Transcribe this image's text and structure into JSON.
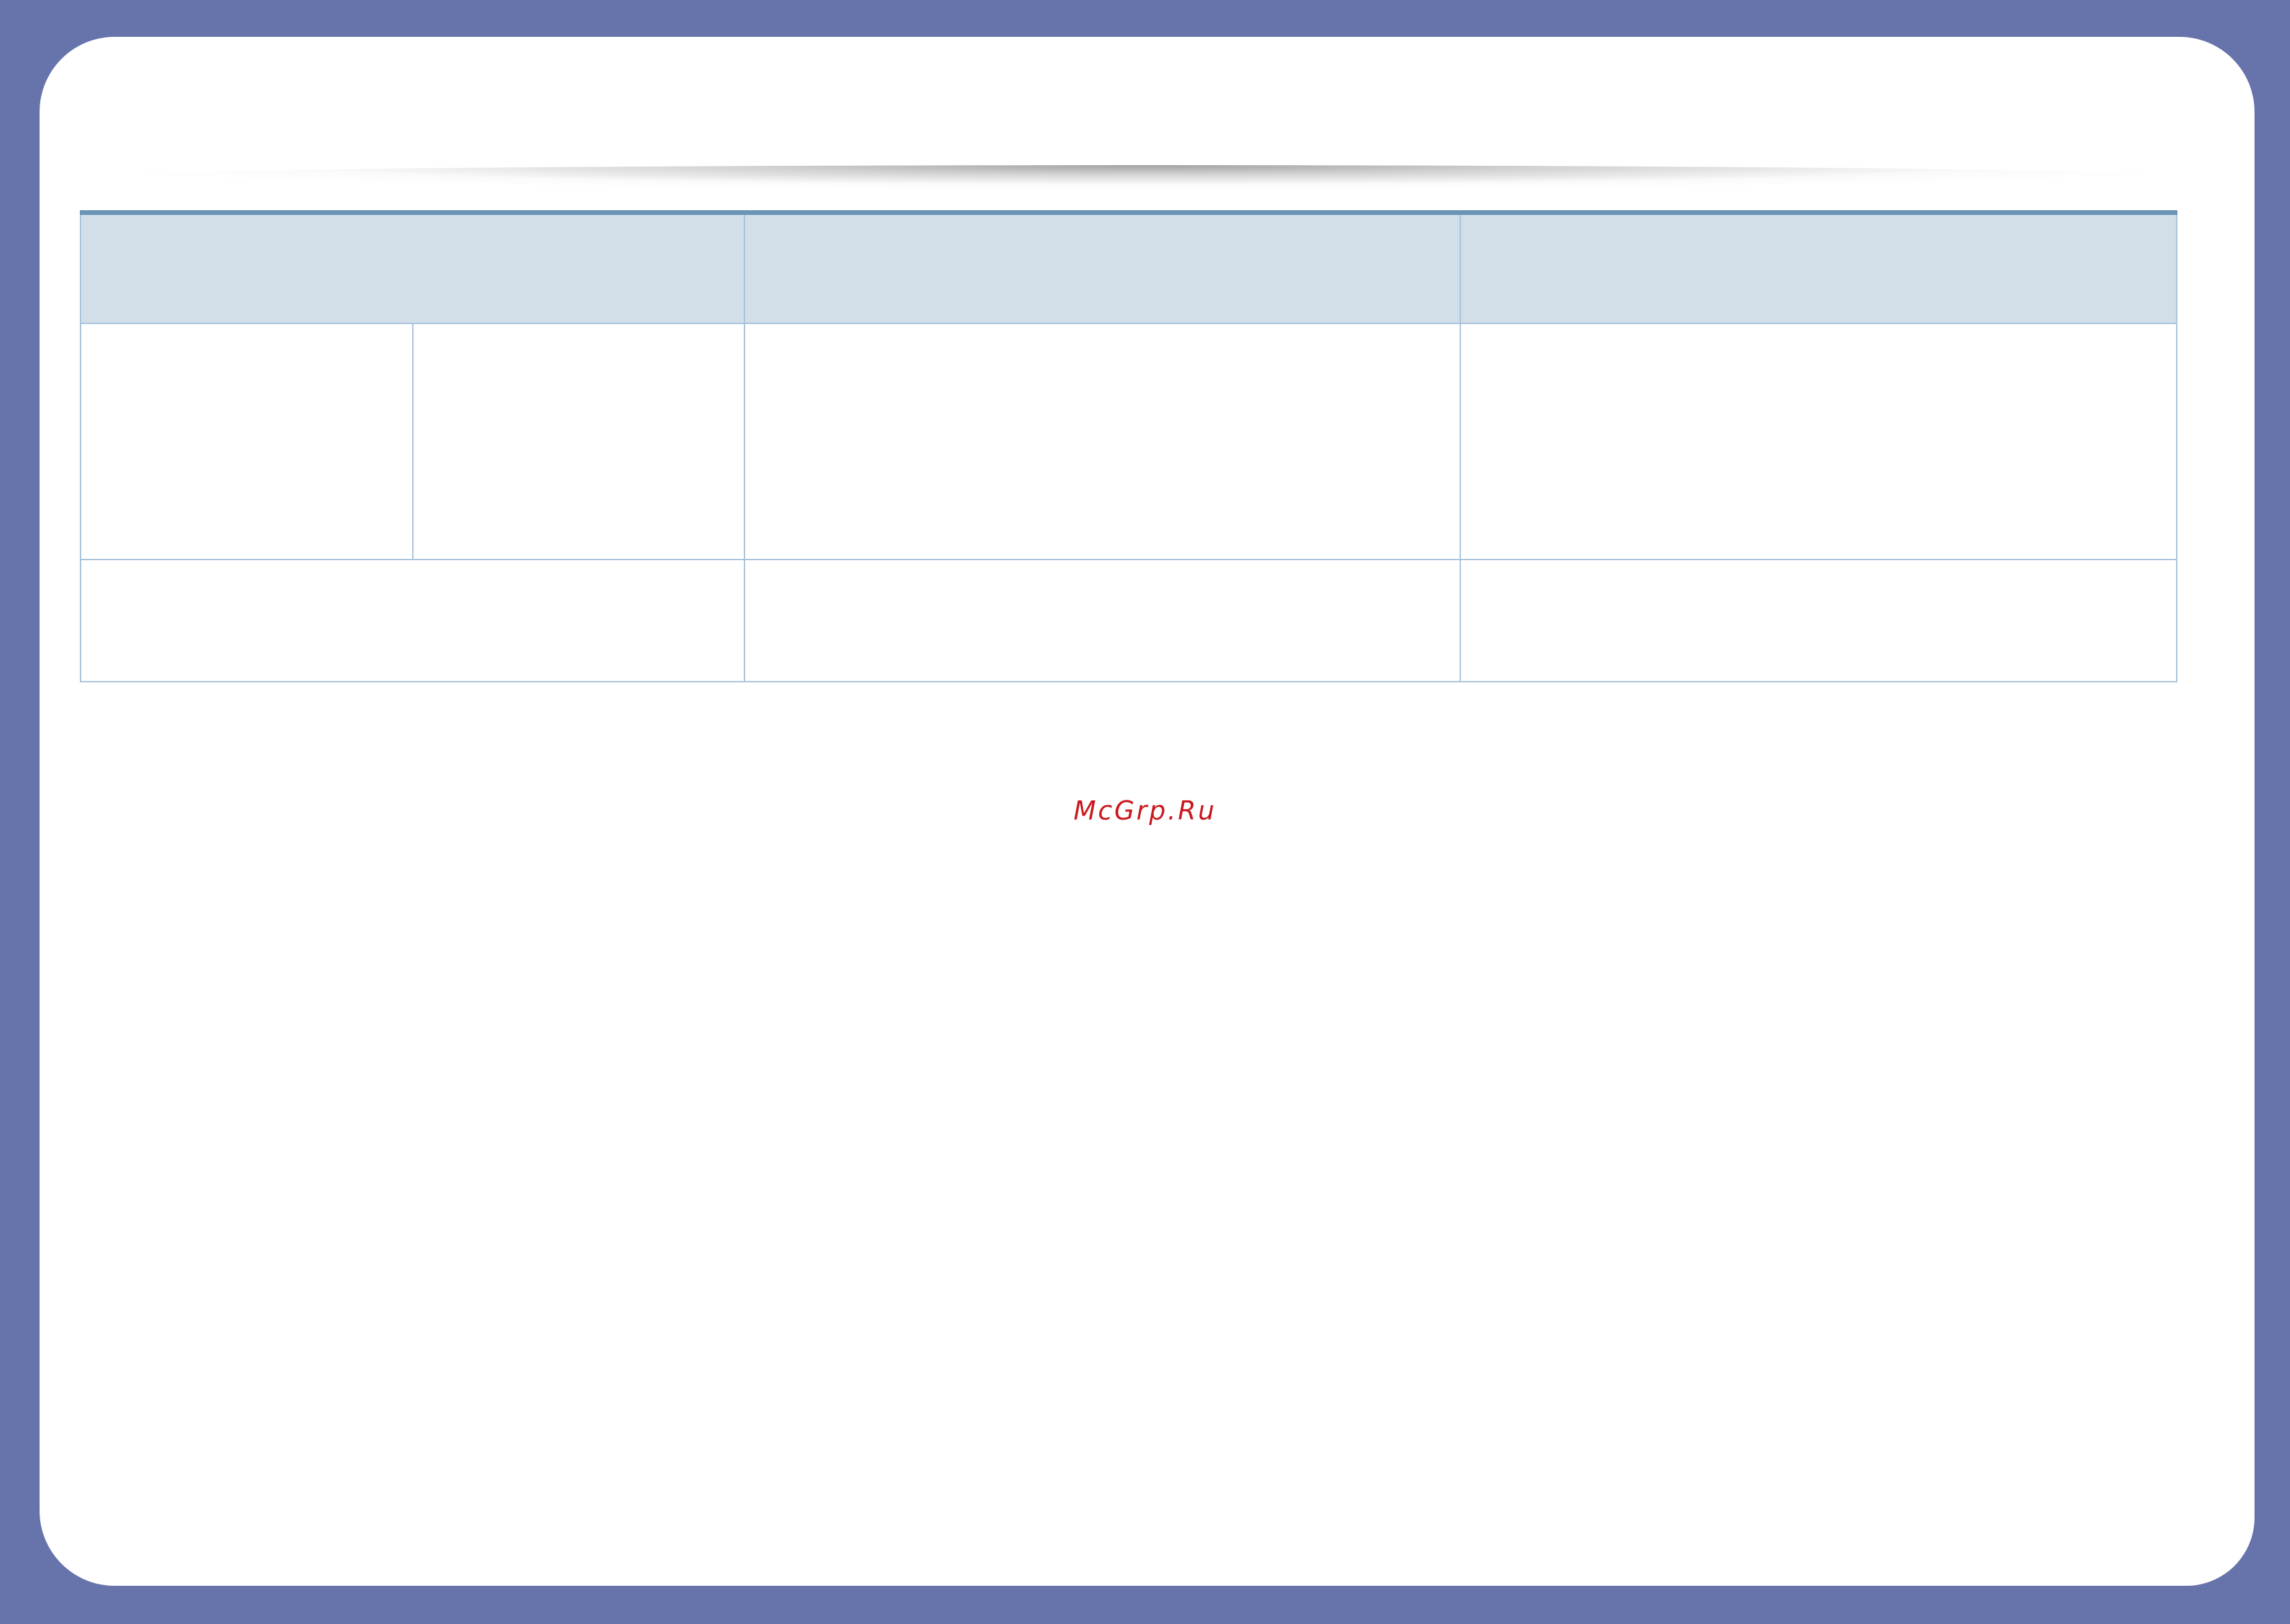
{
  "table": {
    "header": [
      "",
      "",
      ""
    ],
    "rows": [
      [
        "",
        "",
        "",
        ""
      ],
      [
        "",
        "",
        ""
      ]
    ]
  },
  "watermark": "McGrp.Ru",
  "colors": {
    "frame": "#6674ab",
    "header_fill": "#d2dee8",
    "table_rule": "#6a93b7",
    "grid_line": "#a9c3db",
    "watermark": "#c8191e"
  }
}
